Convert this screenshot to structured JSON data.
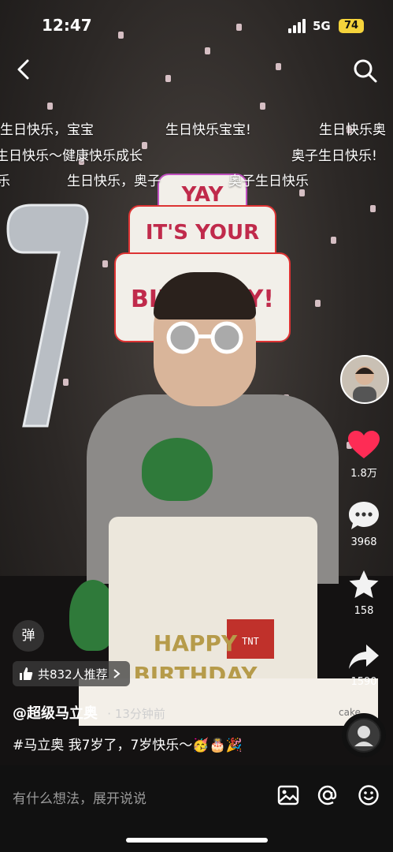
{
  "status_bar": {
    "time": "12:47",
    "network": "5G",
    "battery": "74"
  },
  "danmu": [
    {
      "text": "生日快乐，宝宝",
      "row": 1
    },
    {
      "text": "生日快乐宝宝!",
      "row": 1
    },
    {
      "text": "生日快乐奥",
      "row": 1
    },
    {
      "text": "生日快乐～健康快乐成长",
      "row": 2
    },
    {
      "text": "奥子生日快乐!",
      "row": 2
    },
    {
      "text": "乐",
      "row": 3
    },
    {
      "text": "生日快乐，奥子",
      "row": 3
    },
    {
      "text": "奥子生日快乐",
      "row": 3
    }
  ],
  "balloon": {
    "line1": "YAY",
    "line2": "IT'S YOUR",
    "line3": "BIRTHDAY!"
  },
  "cake_text": {
    "happy": "HAPPY",
    "birthday": "BIRTHDAY",
    "tnt": "TNT",
    "brand": "cake"
  },
  "actions": {
    "likes": "1.8万",
    "comments": "3968",
    "favorites": "158",
    "shares": "1590"
  },
  "danmaku_toggle": "弹",
  "recommend": "共832人推荐",
  "author": {
    "name": "@超级马立奥",
    "time_ago": "13分钟前"
  },
  "caption": "#马立奥 我7岁了，7岁快乐～🥳🎂🎉",
  "comment_placeholder": "有什么想法，展开说说",
  "colors": {
    "like": "#fe2c55",
    "battery": "#f5d33b"
  },
  "icons": [
    "back-icon",
    "search-icon",
    "heart-icon",
    "comment-icon",
    "star-icon",
    "share-icon",
    "image-icon",
    "at-icon",
    "emoji-icon"
  ]
}
